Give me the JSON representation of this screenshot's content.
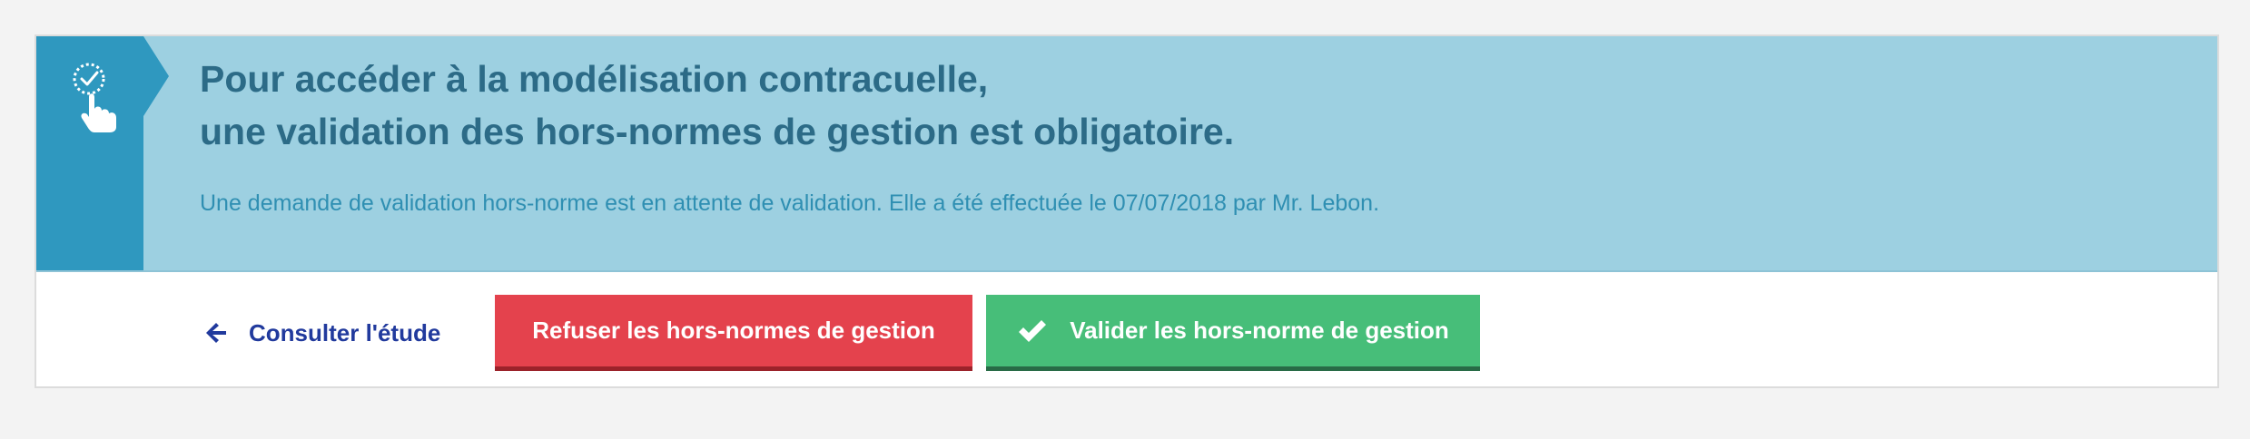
{
  "banner": {
    "title_line_1": "Pour accéder à la modélisation contracuelle,",
    "title_line_2": "une validation des hors-normes de gestion est obligatoire.",
    "message": "Une demande de validation hors-norme est en attente de validation. Elle a été effectuée le 07/07/2018 par Mr. Lebon.",
    "icon": "hand-click-check-icon"
  },
  "actions": {
    "back_label": "Consulter l'étude",
    "back_icon": "arrow-left-icon",
    "refuse_label": "Refuser les hors-normes de gestion",
    "validate_label": "Valider les hors-norme de gestion",
    "validate_icon": "checkmark-icon"
  },
  "colors": {
    "page_background": "#f3f3f3",
    "banner_background": "#9dd0e1",
    "banner_tab": "#2f98bf",
    "title_text": "#2c6b87",
    "message_text": "#2f8fb2",
    "link_text": "#213a9d",
    "refuse_button": "#e4424d",
    "validate_button": "#47be79"
  }
}
